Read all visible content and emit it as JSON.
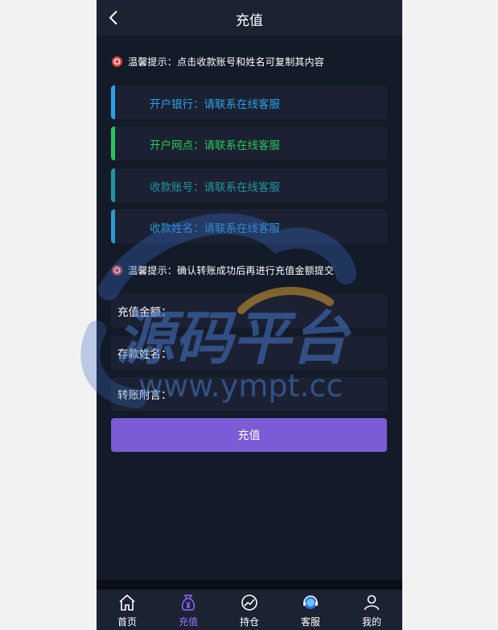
{
  "header": {
    "title": "充值"
  },
  "tips": {
    "first": "温馨提示：点击收款账号和姓名可复制其内容",
    "second": "温馨提示：确认转账成功后再进行充值金额提交"
  },
  "cards": [
    {
      "label": "开户银行：",
      "value": "请联系在线客服",
      "color": "#2aa3e8"
    },
    {
      "label": "开户网点：",
      "value": "请联系在线客服",
      "color": "#27c75a"
    },
    {
      "label": "收款账号：",
      "value": "请联系在线客服",
      "color": "#1f97a1"
    },
    {
      "label": "收款姓名：",
      "value": "请联系在线客服",
      "color": "#2a9bd3"
    }
  ],
  "form": {
    "amount_label": "充值金额：",
    "amount_value": "",
    "name_label": "存款姓名：",
    "name_value": "",
    "remark_label": "转账附言：",
    "remark_value": "",
    "submit_label": "充值"
  },
  "watermark": {
    "line1": "源码平台",
    "line2": "www.ympt.cc"
  },
  "nav": [
    {
      "label": "首页",
      "icon": "home-icon",
      "active": false
    },
    {
      "label": "充值",
      "icon": "money-bag-icon",
      "active": true
    },
    {
      "label": "持仓",
      "icon": "chart-icon",
      "active": false
    },
    {
      "label": "客服",
      "icon": "support-icon",
      "active": false
    },
    {
      "label": "我的",
      "icon": "user-icon",
      "active": false
    }
  ],
  "colors": {
    "accent": "#7b5bd6",
    "background": "#131a28",
    "surface": "#1b2132"
  }
}
